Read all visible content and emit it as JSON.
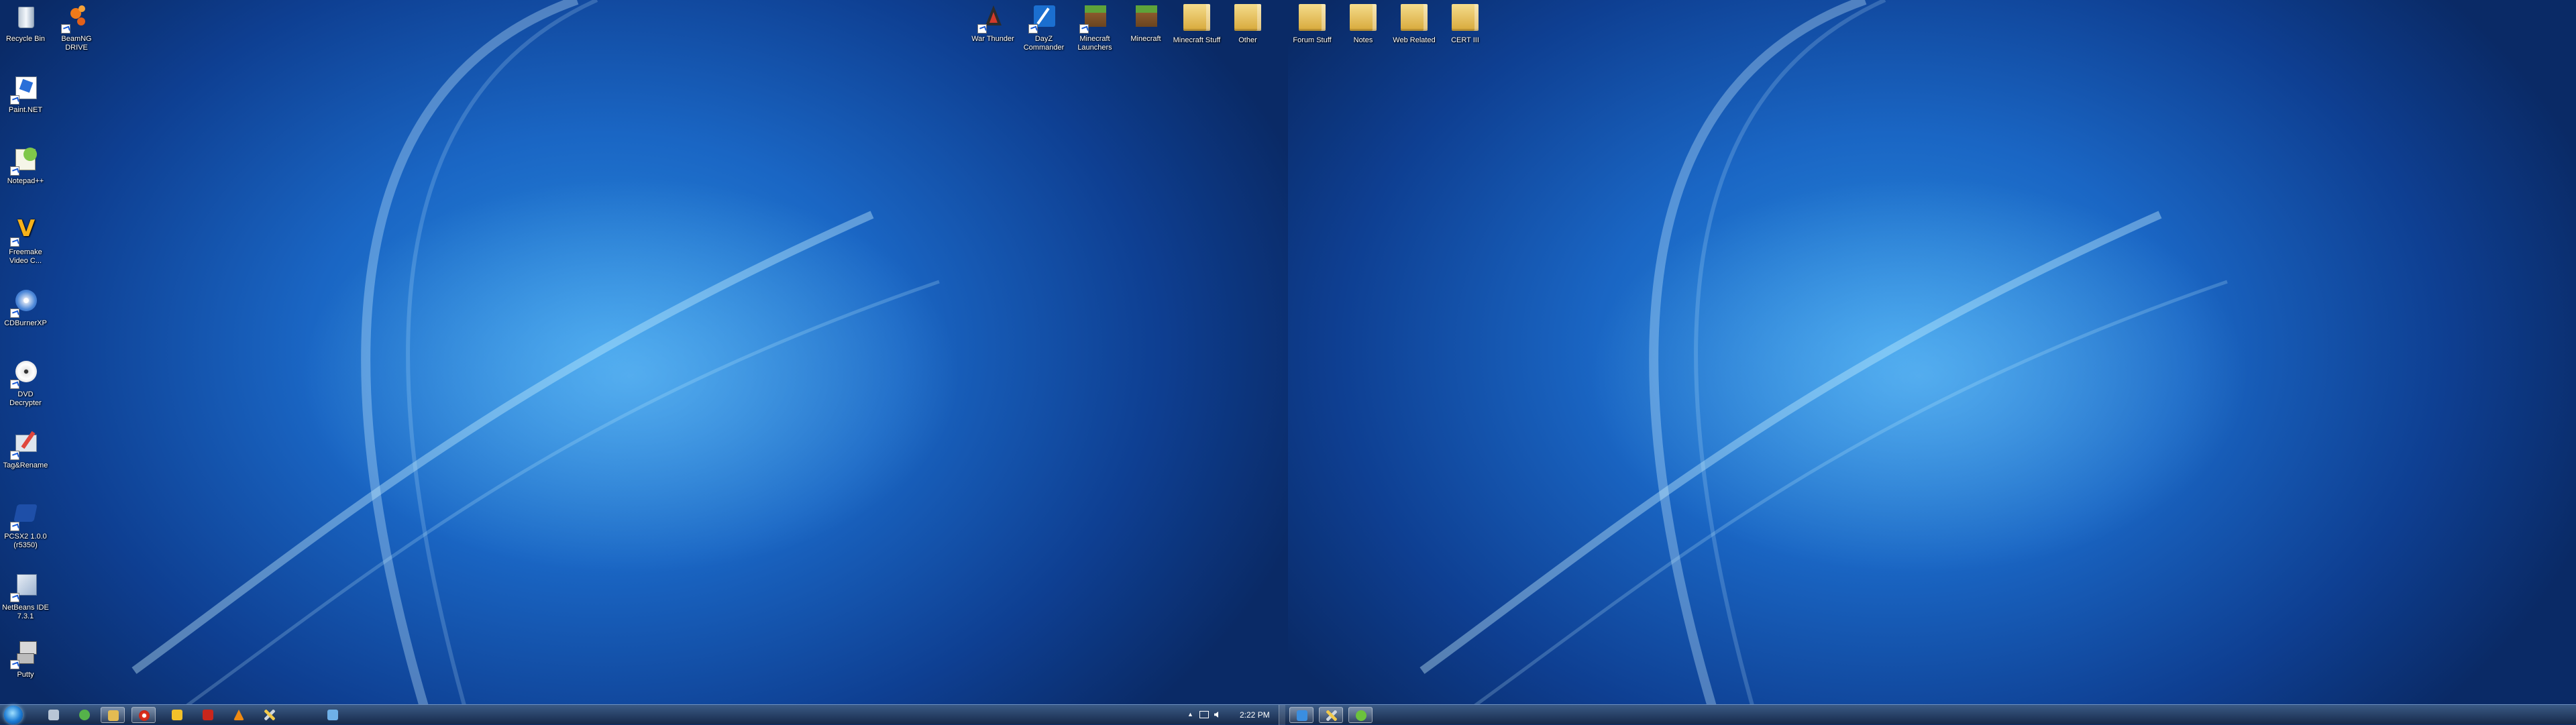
{
  "desktop_left": {
    "column_icons": [
      {
        "label": "Recycle Bin",
        "icon": "recycle-bin-icon"
      },
      {
        "label": "Paint.NET",
        "icon": "paint-net-icon"
      },
      {
        "label": "Notepad++",
        "icon": "notepad-plus-plus-icon"
      },
      {
        "label": "Freemake Video C...",
        "icon": "freemake-icon"
      },
      {
        "label": "CDBurnerXP",
        "icon": "cdburnerxp-icon"
      },
      {
        "label": "DVD Decrypter",
        "icon": "dvd-icon"
      },
      {
        "label": "Tag&Rename",
        "icon": "tag-rename-icon"
      },
      {
        "label": "PCSX2 1.0.0 (r5350)",
        "icon": "pcsx2-icon"
      },
      {
        "label": "NetBeans IDE 7.3.1",
        "icon": "netbeans-icon"
      },
      {
        "label": "Putty",
        "icon": "putty-icon"
      }
    ],
    "beamng": {
      "label": "BeamNG DRIVE",
      "icon": "beamng-icon"
    },
    "top_icons": [
      {
        "label": "War Thunder",
        "icon": "war-thunder-icon"
      },
      {
        "label": "DayZ Commander",
        "icon": "dayz-commander-icon"
      },
      {
        "label": "Minecraft Launchers",
        "icon": "minecraft-icon"
      },
      {
        "label": "Minecraft",
        "icon": "minecraft-icon"
      },
      {
        "label": "Minecraft Stuff",
        "icon": "folder-icon"
      },
      {
        "label": "Other",
        "icon": "folder-icon"
      }
    ]
  },
  "desktop_right": {
    "top_icons": [
      {
        "label": "Forum Stuff",
        "icon": "folder-icon"
      },
      {
        "label": "Notes",
        "icon": "folder-icon"
      },
      {
        "label": "Web Related",
        "icon": "folder-icon"
      },
      {
        "label": "CERT III",
        "icon": "folder-icon"
      }
    ]
  },
  "taskbar_left": {
    "start_icon": "windows-start-icon",
    "buttons": [
      "explorer-icon",
      "chat-icon",
      "folder-icon",
      "browser-icon",
      "note-icon",
      "filezilla-icon",
      "vlc-icon",
      "tools-icon",
      "message-icon"
    ],
    "tray": {
      "chevron": "▲",
      "clock": "2:22 PM"
    }
  },
  "taskbar_right": {
    "buttons": [
      "window-icon",
      "tools-icon",
      "spotify-icon"
    ]
  },
  "colors": {
    "wallpaper": "#1a66c4",
    "taskbar": "#1f3a63",
    "folder": "#e8c25a"
  }
}
